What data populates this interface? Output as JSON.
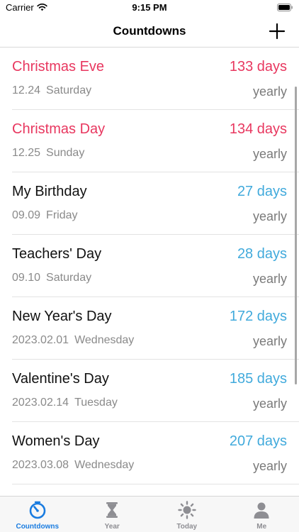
{
  "status_bar": {
    "carrier": "Carrier",
    "time": "9:15 PM"
  },
  "nav": {
    "title": "Countdowns",
    "add_icon": "plus-icon"
  },
  "colors": {
    "accent_blue": "#1a7ce0",
    "holiday_red": "#e8375f",
    "days_blue": "#41aadc",
    "tab_inactive": "#8e8e93"
  },
  "countdowns": [
    {
      "title": "Christmas Eve",
      "days": "133 days",
      "date": "12.24",
      "weekday": "Saturday",
      "repeat": "yearly",
      "highlight": true
    },
    {
      "title": "Christmas Day",
      "days": "134 days",
      "date": "12.25",
      "weekday": "Sunday",
      "repeat": "yearly",
      "highlight": true
    },
    {
      "title": "My Birthday",
      "days": "27 days",
      "date": "09.09",
      "weekday": "Friday",
      "repeat": "yearly",
      "highlight": false
    },
    {
      "title": "Teachers' Day",
      "days": "28 days",
      "date": "09.10",
      "weekday": "Saturday",
      "repeat": "yearly",
      "highlight": false
    },
    {
      "title": "New Year's Day",
      "days": "172 days",
      "date": "2023.02.01",
      "weekday": "Wednesday",
      "repeat": "yearly",
      "highlight": false
    },
    {
      "title": "Valentine's Day",
      "days": "185 days",
      "date": "2023.02.14",
      "weekday": "Tuesday",
      "repeat": "yearly",
      "highlight": false
    },
    {
      "title": "Women's Day",
      "days": "207 days",
      "date": "2023.03.08",
      "weekday": "Wednesday",
      "repeat": "yearly",
      "highlight": false
    }
  ],
  "tabs": [
    {
      "label": "Countdowns",
      "icon": "stopwatch-icon",
      "active": true
    },
    {
      "label": "Year",
      "icon": "hourglass-icon",
      "active": false
    },
    {
      "label": "Today",
      "icon": "sun-icon",
      "active": false
    },
    {
      "label": "Me",
      "icon": "person-icon",
      "active": false
    }
  ]
}
